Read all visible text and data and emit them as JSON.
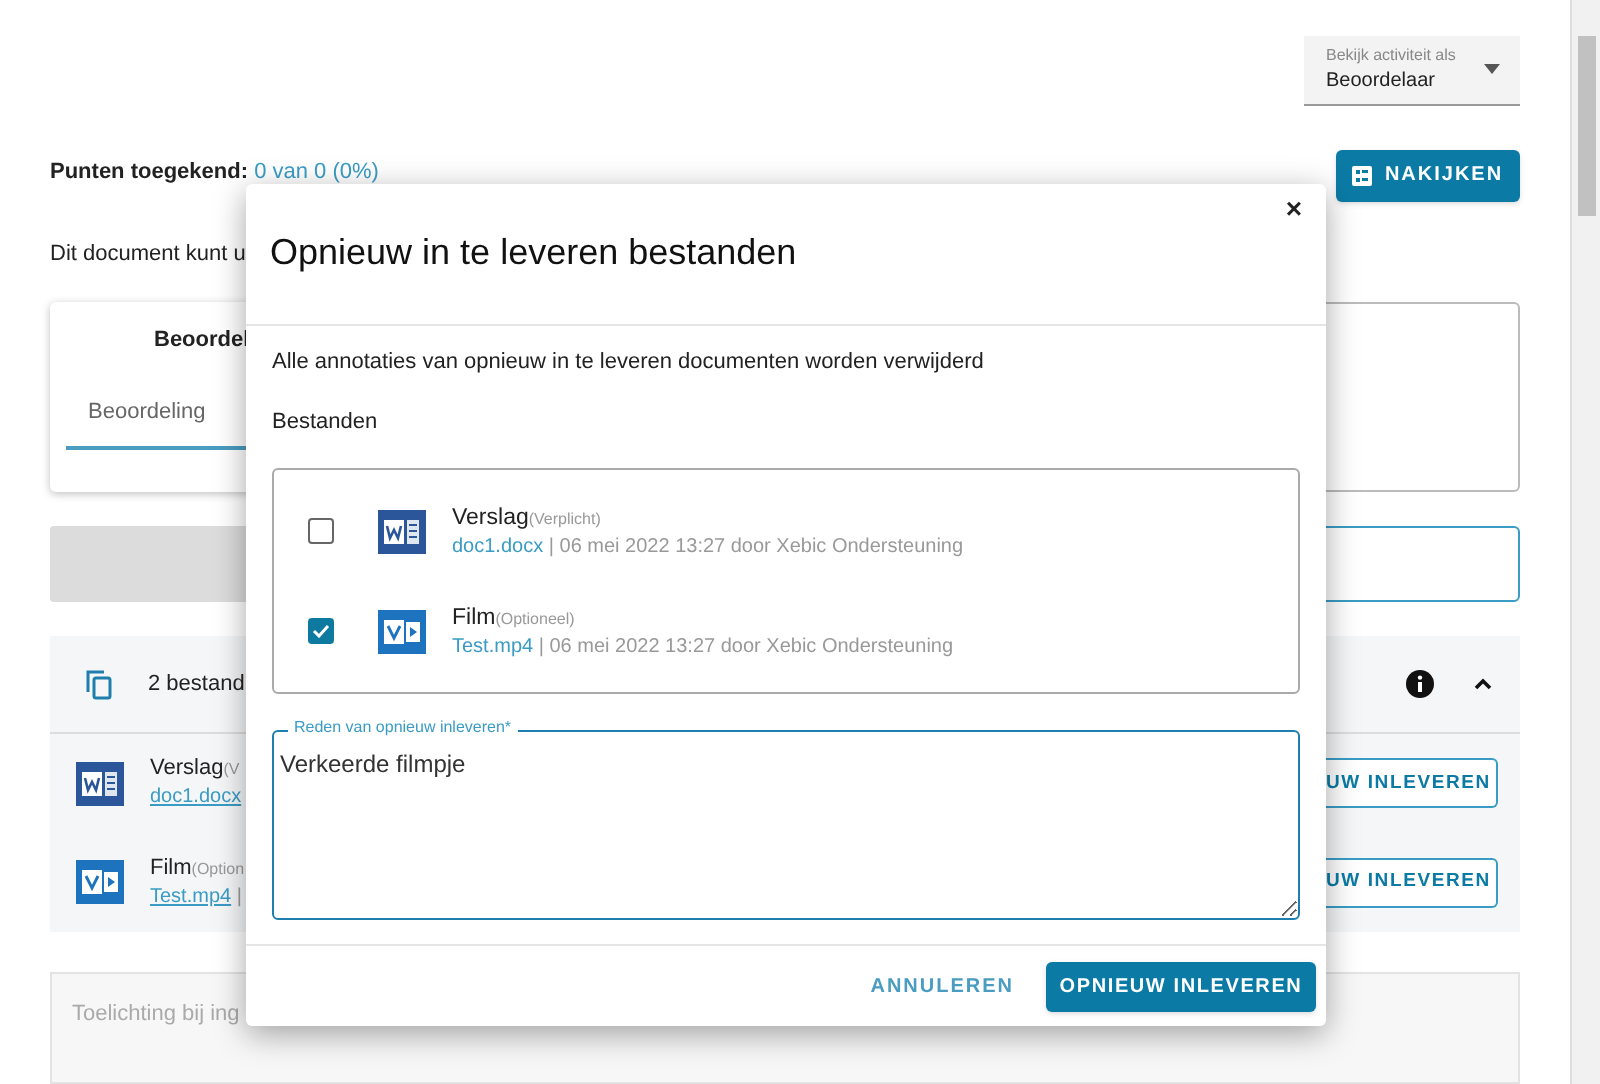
{
  "view_as": {
    "label": "Bekijk activiteit als",
    "value": "Beoordelaar"
  },
  "points": {
    "label": "Punten toegekend:",
    "value": "0 van 0 (0%)"
  },
  "grade_button": "NAKIJKEN",
  "notice": "Dit document kunt u",
  "assessment_card": {
    "title": "Beoordel",
    "tabs": [
      {
        "label": "Beoordeling",
        "selected": true
      }
    ]
  },
  "files_panel": {
    "summary": "2 bestand",
    "expanded": true,
    "files": [
      {
        "kind": "word",
        "name": "Verslag",
        "tag": "(V",
        "file": "doc1.docx",
        "button": "UW INLEVEREN"
      },
      {
        "kind": "video",
        "name": "Film",
        "tag": "(Option",
        "file": "Test.mp4",
        "meta": "|",
        "button": "UW INLEVEREN"
      }
    ]
  },
  "comment_placeholder": "Toelichting bij ing",
  "dialog": {
    "title": "Opnieuw in te leveren bestanden",
    "close": "×",
    "message": "Alle annotaties van opnieuw in te leveren documenten worden verwijderd",
    "files_label": "Bestanden",
    "files": [
      {
        "kind": "word",
        "name": "Verslag",
        "tag": "(Verplicht)",
        "file": "doc1.docx",
        "meta": "| 06 mei 2022 13:27 door Xebic Ondersteuning",
        "checked": false
      },
      {
        "kind": "video",
        "name": "Film",
        "tag": "(Optioneel)",
        "file": "Test.mp4",
        "meta": "| 06 mei 2022 13:27 door Xebic Ondersteuning",
        "checked": true
      }
    ],
    "reason": {
      "label": "Reden van opnieuw inleveren*",
      "value": "Verkeerde filmpje"
    },
    "buttons": {
      "cancel": "ANNULEREN",
      "submit": "OPNIEUW INLEVEREN"
    }
  }
}
